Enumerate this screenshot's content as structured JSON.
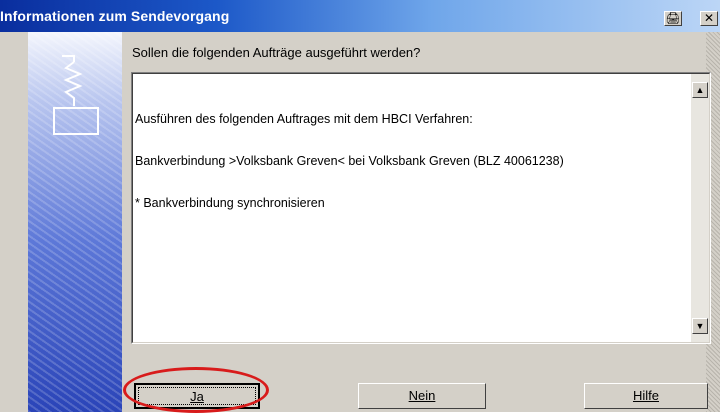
{
  "window": {
    "title": "Informationen zum Sendevorgang",
    "title_buttons": [
      {
        "name": "printer-icon",
        "glyph": "🖨"
      },
      {
        "name": "close-icon",
        "glyph": "✕"
      }
    ]
  },
  "dialog": {
    "question": "Sollen die folgenden Aufträge ausgeführt werden?",
    "details": [
      "Ausführen des folgenden Auftrages mit dem HBCI Verfahren:",
      "Bankverbindung >Volksbank Greven< bei Volksbank Greven (BLZ 40061238)",
      "* Bankverbindung synchronisieren"
    ],
    "scroll_up": "▲",
    "scroll_down": "▼"
  },
  "buttons": {
    "yes": "Ja",
    "no": "Nein",
    "help": "Hilfe"
  },
  "colors": {
    "title_start": "#0a2e9e",
    "highlight_circle": "#d81b1b"
  }
}
